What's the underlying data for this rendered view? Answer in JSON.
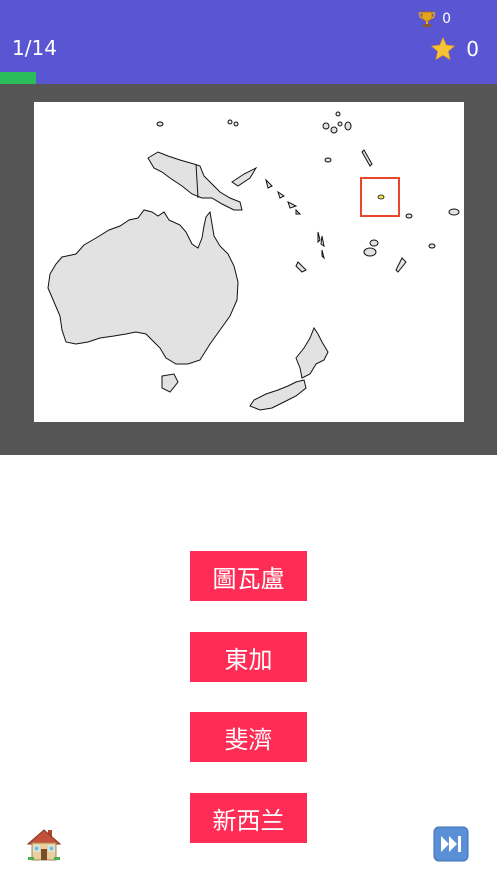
{
  "header": {
    "progress": "1/14",
    "trophy_count": "0",
    "star_count": "0",
    "progress_fraction": 0.0714,
    "bg_color": "#5a56d3",
    "progress_color": "#2bbd5a"
  },
  "map": {
    "highlight_color": "#e8472b"
  },
  "answers": [
    {
      "label": "圖瓦盧"
    },
    {
      "label": "東加"
    },
    {
      "label": "斐濟"
    },
    {
      "label": "新西兰"
    }
  ],
  "answer_color": "#ff2d55",
  "icons": {
    "trophy": "trophy-icon",
    "star": "star-icon",
    "home": "home-icon",
    "skip": "fast-forward-icon"
  }
}
